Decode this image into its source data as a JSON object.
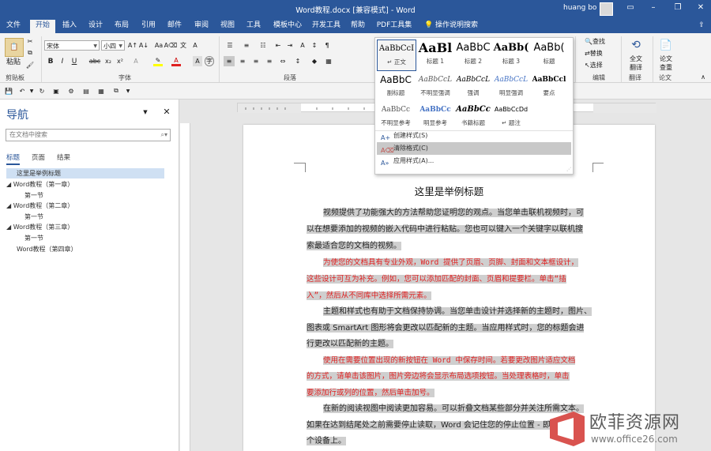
{
  "window": {
    "title": "Word教程.docx [兼容模式] - Word",
    "user": "huang bo"
  },
  "tabs": [
    "文件",
    "开始",
    "插入",
    "设计",
    "布局",
    "引用",
    "邮件",
    "审阅",
    "视图",
    "工具",
    "模板中心",
    "开发工具",
    "帮助",
    "PDF工具集"
  ],
  "tell_me": "操作说明搜索",
  "share_label": "",
  "ribbon": {
    "paste": "粘贴",
    "clipboard_group": "剪贴板",
    "font_group": "字体",
    "paragraph_group": "段落",
    "editing_group": "编辑",
    "font_name": "宋体",
    "font_size": "小四",
    "find": "查找",
    "replace": "替换",
    "select": "选择",
    "translate_full": "全文\n翻译",
    "translate_label1": "全文",
    "translate_label2": "翻译",
    "thesis_label1": "论文",
    "thesis_label2": "查重",
    "translate_group": "翻译",
    "thesis_group": "论文"
  },
  "style_gallery": {
    "styles": [
      {
        "preview": "AaBbCcI",
        "name": "↵ 正文"
      },
      {
        "preview": "AaBl",
        "name": "标题 1"
      },
      {
        "preview": "AaBbC",
        "name": "标题 2"
      },
      {
        "preview": "AaBb(",
        "name": "标题 3"
      },
      {
        "preview": "AaBb(",
        "name": "标题"
      },
      {
        "preview": "AaBbC",
        "name": "副标题"
      },
      {
        "preview": "AaBbCcL",
        "name": "不明显强调"
      },
      {
        "preview": "AaBbCcL",
        "name": "强调"
      },
      {
        "preview": "AaBbCcL",
        "name": "明显强调"
      },
      {
        "preview": "AaBbCcl",
        "name": "要点"
      },
      {
        "preview": "AaBbCc",
        "name": "不明显参考"
      },
      {
        "preview": "AaBbCc",
        "name": "明显参考"
      },
      {
        "preview": "AaBbCc",
        "name": "书籍标题"
      },
      {
        "preview": "AaBbCcDd",
        "name": "↵ 题注"
      }
    ],
    "menu": [
      "创建样式(S)",
      "清除格式(C)",
      "应用样式(A)..."
    ]
  },
  "navigation": {
    "title": "导航",
    "search_placeholder": "在文档中搜索",
    "tabs": [
      "标题",
      "页面",
      "结果"
    ],
    "items": [
      "这里是举例标题",
      "Word教程（第一章）",
      "第一节",
      "Word教程（第二章）",
      "第一节",
      "Word教程（第三章）",
      "第一节",
      "Word教程（第四章）"
    ]
  },
  "document": {
    "title": "这里是举例标题",
    "lines": [
      "视频提供了功能强大的方法帮助您证明您的观点。当您单击联机视频时，可",
      "以在想要添加的视频的嵌入代码中进行粘贴。您也可以键入一个关键字以联机搜",
      "索最适合您的文档的视频。",
      "为使您的文档具有专业外观，Word 提供了页眉、页脚、封面和文本框设计，",
      "这些设计可互为补充。例如，您可以添加匹配的封面、页眉和提要栏。单击“插",
      "入”，然后从不同库中选择所需元素。",
      "主题和样式也有助于文档保持协调。当您单击设计并选择新的主题时，图片、",
      "图表或 SmartArt 图形将会更改以匹配新的主题。当应用样式时，您的标题会进",
      "行更改以匹配新的主题。",
      "使用在需要位置出现的新按钮在 Word 中保存时间。若要更改图片适应文档",
      "的方式，请单击该图片，图片旁边将会显示布局选项按钮。当处理表格时，单击",
      "要添加行或列的位置，然后单击加号。",
      "在新的阅读视图中阅读更加容易。可以折叠文档某些部分并关注所需文本。",
      "如果在达到结尾处之前需要停止读取，Word 会记住您的停止位置 - 即使在另一",
      "个设备上。"
    ]
  },
  "watermark": {
    "name": "欧菲资源网",
    "url": "www.office26.com"
  },
  "colors": {
    "accent": "#2b579a",
    "red_text": "#e02020",
    "highlight": "#cfcfcf"
  }
}
